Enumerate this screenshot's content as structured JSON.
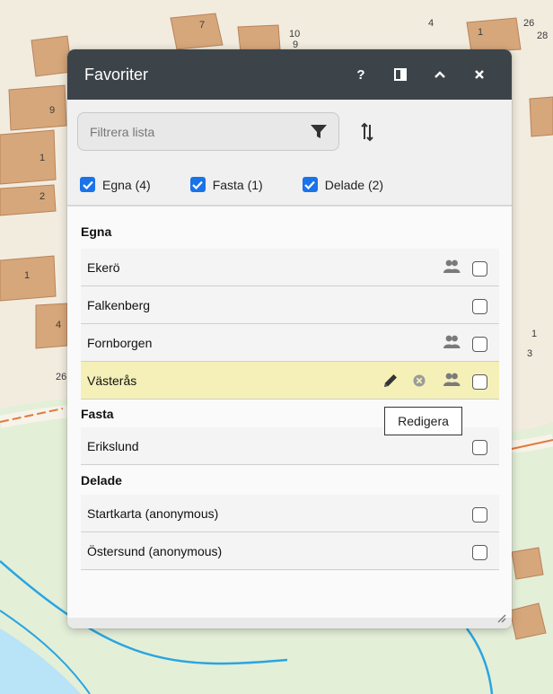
{
  "panel": {
    "title": "Favoriter",
    "help_label": "?",
    "filter_placeholder": "Filtrera lista"
  },
  "checks": [
    {
      "label": "Egna (4)",
      "checked": true
    },
    {
      "label": "Fasta (1)",
      "checked": true
    },
    {
      "label": "Delade (2)",
      "checked": true
    }
  ],
  "sections": {
    "own": {
      "title": "Egna",
      "items": [
        {
          "name": "Ekerö",
          "shared": true
        },
        {
          "name": "Falkenberg",
          "shared": false
        },
        {
          "name": "Fornborgen",
          "shared": true
        },
        {
          "name": "Västerås",
          "shared": true,
          "selected": true
        }
      ]
    },
    "fixed": {
      "title": "Fasta",
      "items": [
        {
          "name": "Erikslund",
          "shared": false
        }
      ]
    },
    "shared": {
      "title": "Delade",
      "items": [
        {
          "name": "Startkarta (anonymous)",
          "shared": false
        },
        {
          "name": "Östersund (anonymous)",
          "shared": false
        }
      ]
    }
  },
  "tooltip": "Redigera",
  "map_labels": {
    "l1": "7",
    "l2": "10",
    "l3": "9",
    "l4": "4",
    "l5": "1",
    "l6": "26",
    "l7": "28",
    "l8": "9",
    "l9": "1",
    "l10": "2",
    "l11": "1",
    "l12": "4",
    "l13": "26",
    "l14": "1",
    "l15": "3"
  },
  "colors": {
    "titlebar": "#3d4449",
    "checkbox_checked": "#1a73e8",
    "selected_row": "#f5f0b8",
    "map_building": "#d6a77b",
    "map_land": "#f2ecdf",
    "map_green": "#e4efd8",
    "map_water": "#29a5e0"
  }
}
